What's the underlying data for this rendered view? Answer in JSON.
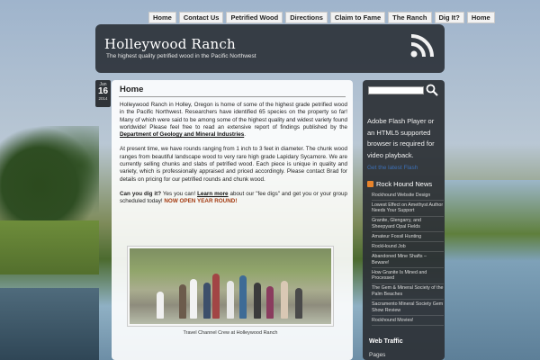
{
  "nav": {
    "items": [
      "Home",
      "Contact Us",
      "Petrified Wood",
      "Directions",
      "Claim to Fame",
      "The Ranch",
      "Dig It?",
      "Home"
    ]
  },
  "header": {
    "title": "Holleywood Ranch",
    "tagline": "The highest quality petrified wood in the Pacific Northwest",
    "rss_icon": "rss-icon"
  },
  "post": {
    "date": {
      "month": "Jan",
      "day": "16",
      "year": "2014"
    },
    "title": "Home",
    "p1_a": "Holleywood Ranch in Holley, Oregon is home of some of the highest grade petrified wood in the Pacific Northwest. Researchers have identified 65 species on the property so far!  Many of which were said to be among some of the highest quality and widest variety found worldwide!  Please feel free to read an extensive report of findings published by the ",
    "p1_link": "Department of Geology and Mineral Industries",
    "p1_b": ".",
    "p2": "At present time, we have rounds ranging from 1 inch to 3 feet in diameter. The chunk wood ranges from beautiful landscape wood to very rare high grade Lapidary Sycamore. We are currently selling chunks and slabs of petrified wood.  Each piece is unique in quality and variety, which is professionally appraised and priced accordingly. Please contact Brad for details on pricing for our petrified rounds and chunk wood.",
    "p3_q": "Can you dig it?",
    "p3_a": "  Yes you can! ",
    "p3_link": "Learn more",
    "p3_b": " about our \"fee digs\" and get you or your group scheduled today! ",
    "p3_highlight": "NOW OPEN YEAR ROUND!",
    "photo_caption": "Travel Channel Crew at Holleywood Ranch"
  },
  "sidebar": {
    "search_placeholder": "",
    "flash_msg": "Adobe Flash Player or an HTML5 supported browser is required for video playback.",
    "flash_link": "Get the latest Flash",
    "news_title": "Rock Hound News",
    "news": [
      "Rockhound Website Design",
      "Lowest Effect on Amethyst Author Needs Your Support",
      "Granite, Glengarry, and Sheepyard Opal Fields",
      "Amateur Fossil Hunting",
      "RockHound Job",
      "Abandoned Mine Shafts – Beware!",
      "How Granite Is Mined and Processed",
      "The Gem & Mineral Society of the Palm Beaches",
      "Sacramento Mineral Society Gem Show Review",
      "Rockhound Movies!"
    ],
    "web_traffic": "Web Traffic",
    "pages": "Pages"
  },
  "colors": {
    "header_bg": "#2d323a",
    "accent_link": "#3c6fb5",
    "highlight": "#a33b11",
    "rss_orange": "#e8842b"
  }
}
